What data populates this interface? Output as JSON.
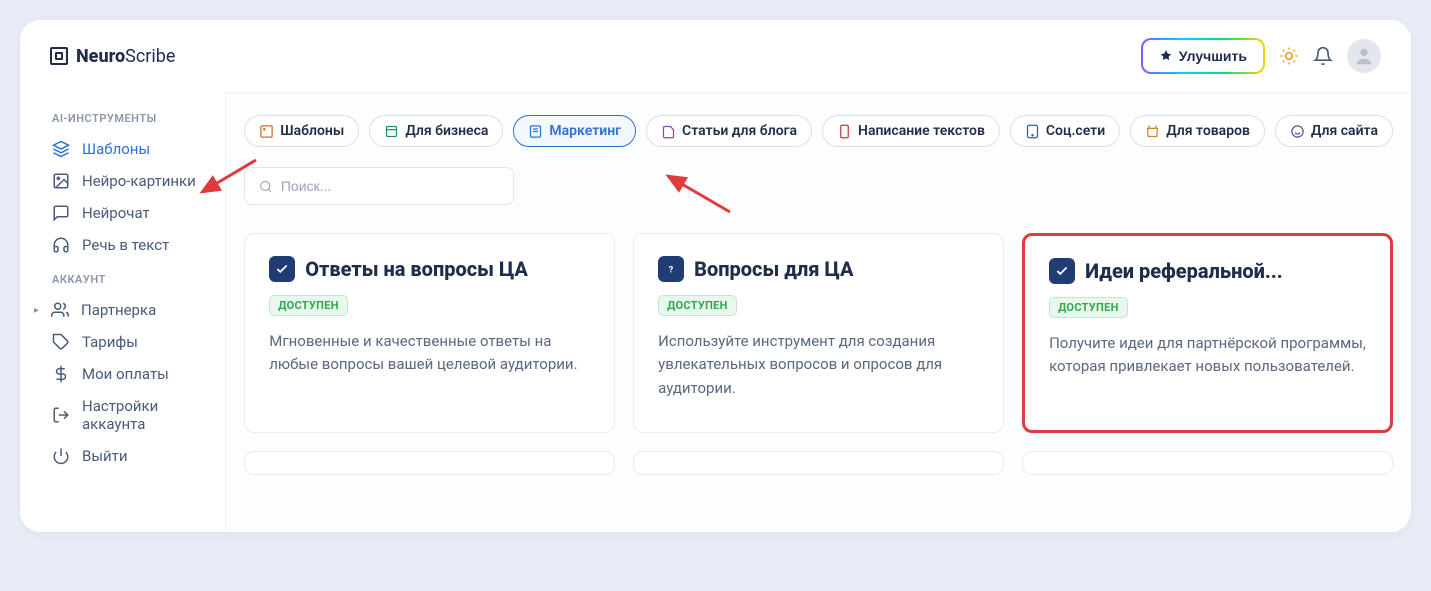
{
  "brand": {
    "name_bold": "Neuro",
    "name_light": "Scribe"
  },
  "header": {
    "upgrade": "Улучшить"
  },
  "sidebar": {
    "section1_title": "AI-ИНСТРУМЕНТЫ",
    "section2_title": "АККАУНТ",
    "items1": [
      {
        "label": "Шаблоны",
        "active": true
      },
      {
        "label": "Нейро-картинки"
      },
      {
        "label": "Нейрочат"
      },
      {
        "label": "Речь в текст"
      }
    ],
    "items2": [
      {
        "label": "Партнерка"
      },
      {
        "label": "Тарифы"
      },
      {
        "label": "Мои оплаты"
      },
      {
        "label": "Настройки аккаунта"
      },
      {
        "label": "Выйти"
      }
    ]
  },
  "filters": [
    {
      "label": "Шаблоны"
    },
    {
      "label": "Для бизнеса"
    },
    {
      "label": "Маркетинг",
      "active": true
    },
    {
      "label": "Статьи для блога"
    },
    {
      "label": "Написание текстов"
    },
    {
      "label": "Соц.сети"
    },
    {
      "label": "Для товаров"
    },
    {
      "label": "Для сайта"
    }
  ],
  "search": {
    "placeholder": "Поиск..."
  },
  "cards": [
    {
      "title": "Ответы на вопросы ЦА",
      "badge": "ДОСТУПЕН",
      "desc": "Мгновенные и качественные ответы на любые вопросы вашей целевой аудитории.",
      "icon": "check"
    },
    {
      "title": "Вопросы для ЦА",
      "badge": "ДОСТУПЕН",
      "desc": "Используйте инструмент для создания увлекательных вопросов и опросов для аудитории.",
      "icon": "question"
    },
    {
      "title": "Идеи реферальной...",
      "badge": "ДОСТУПЕН",
      "desc": "Получите идеи для партнёрской программы, которая привлекает новых пользователей.",
      "icon": "check",
      "highlight": true
    }
  ]
}
